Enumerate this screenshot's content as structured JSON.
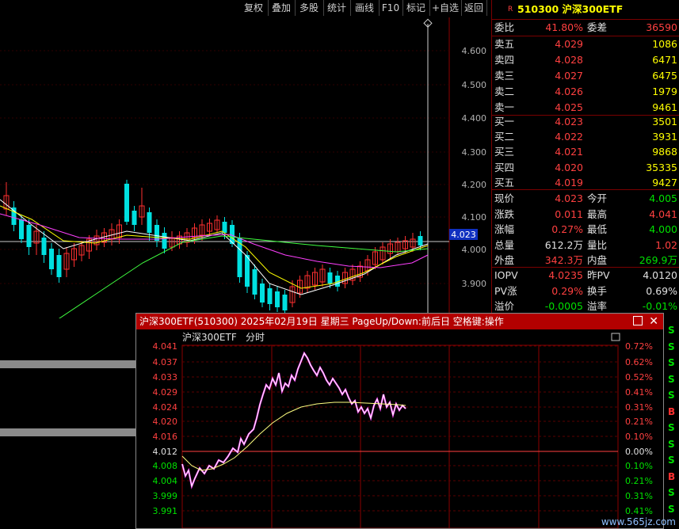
{
  "toolbar": {
    "buttons": [
      "复权",
      "叠加",
      "多股",
      "统计",
      "画线",
      "F10",
      "标记",
      "+自选",
      "返回"
    ]
  },
  "kline_chart": {
    "price_labels": [
      "4.600",
      "4.500",
      "4.400",
      "4.300",
      "4.200",
      "4.100",
      "4.000",
      "3.900"
    ],
    "current_price_tag": "4.023"
  },
  "quote": {
    "badge": "R",
    "title": "510300 沪深300ETF",
    "webi_label": "委比",
    "webi_value": "41.80%",
    "weicha_label": "委差",
    "weicha_value": "36590",
    "asks": [
      {
        "label": "卖五",
        "price": "4.029",
        "vol": "1086"
      },
      {
        "label": "卖四",
        "price": "4.028",
        "vol": "6471"
      },
      {
        "label": "卖三",
        "price": "4.027",
        "vol": "6475"
      },
      {
        "label": "卖二",
        "price": "4.026",
        "vol": "1979"
      },
      {
        "label": "卖一",
        "price": "4.025",
        "vol": "9461"
      }
    ],
    "bids": [
      {
        "label": "买一",
        "price": "4.023",
        "vol": "3501"
      },
      {
        "label": "买二",
        "price": "4.022",
        "vol": "3931"
      },
      {
        "label": "买三",
        "price": "4.021",
        "vol": "9868"
      },
      {
        "label": "买四",
        "price": "4.020",
        "vol": "35335"
      },
      {
        "label": "买五",
        "price": "4.019",
        "vol": "9427"
      }
    ],
    "stats": [
      {
        "l1": "现价",
        "v1": "4.023",
        "c1": "#ff4040",
        "l2": "今开",
        "v2": "4.005",
        "c2": "#00e000"
      },
      {
        "l1": "涨跌",
        "v1": "0.011",
        "c1": "#ff4040",
        "l2": "最高",
        "v2": "4.041",
        "c2": "#ff4040"
      },
      {
        "l1": "涨幅",
        "v1": "0.27%",
        "c1": "#ff4040",
        "l2": "最低",
        "v2": "4.000",
        "c2": "#00e000"
      },
      {
        "l1": "总量",
        "v1": "612.2万",
        "c1": "#e0e0e0",
        "l2": "量比",
        "v2": "1.02",
        "c2": "#ff4040"
      },
      {
        "l1": "外盘",
        "v1": "342.3万",
        "c1": "#ff4040",
        "l2": "内盘",
        "v2": "269.9万",
        "c2": "#00e000"
      }
    ],
    "extra": [
      {
        "l1": "IOPV",
        "v1": "4.0235",
        "c1": "#ff4040",
        "l2": "昨PV",
        "v2": "4.0120",
        "c2": "#e0e0e0"
      },
      {
        "l1": "PV涨",
        "v1": "0.29%",
        "c1": "#ff4040",
        "l2": "换手",
        "v2": "0.69%",
        "c2": "#e0e0e0"
      },
      {
        "l1": "溢价",
        "v1": "-0.0005",
        "c1": "#00e000",
        "l2": "溢率",
        "v2": "-0.01%",
        "c2": "#00e000"
      }
    ]
  },
  "popup": {
    "title": "沪深300ETF(510300) 2025年02月19日 星期三 PageUp/Down:前后日 空格键:操作",
    "subtitle_name": "沪深300ETF",
    "subtitle_mode": "分时",
    "left_labels": [
      "4.041",
      "4.037",
      "4.033",
      "4.029",
      "4.024",
      "4.020",
      "4.016",
      "4.012",
      "4.008",
      "4.004",
      "3.999",
      "3.991"
    ],
    "right_labels": [
      "0.72%",
      "0.62%",
      "0.52%",
      "0.41%",
      "0.31%",
      "0.21%",
      "0.10%",
      "0.00%",
      "0.10%",
      "0.21%",
      "0.31%",
      "0.41%"
    ]
  },
  "bs_column": [
    "S",
    "S",
    "S",
    "S",
    "S",
    "B",
    "S",
    "S",
    "S",
    "B",
    "S",
    "S"
  ],
  "watermark": "www.565jz.com"
}
